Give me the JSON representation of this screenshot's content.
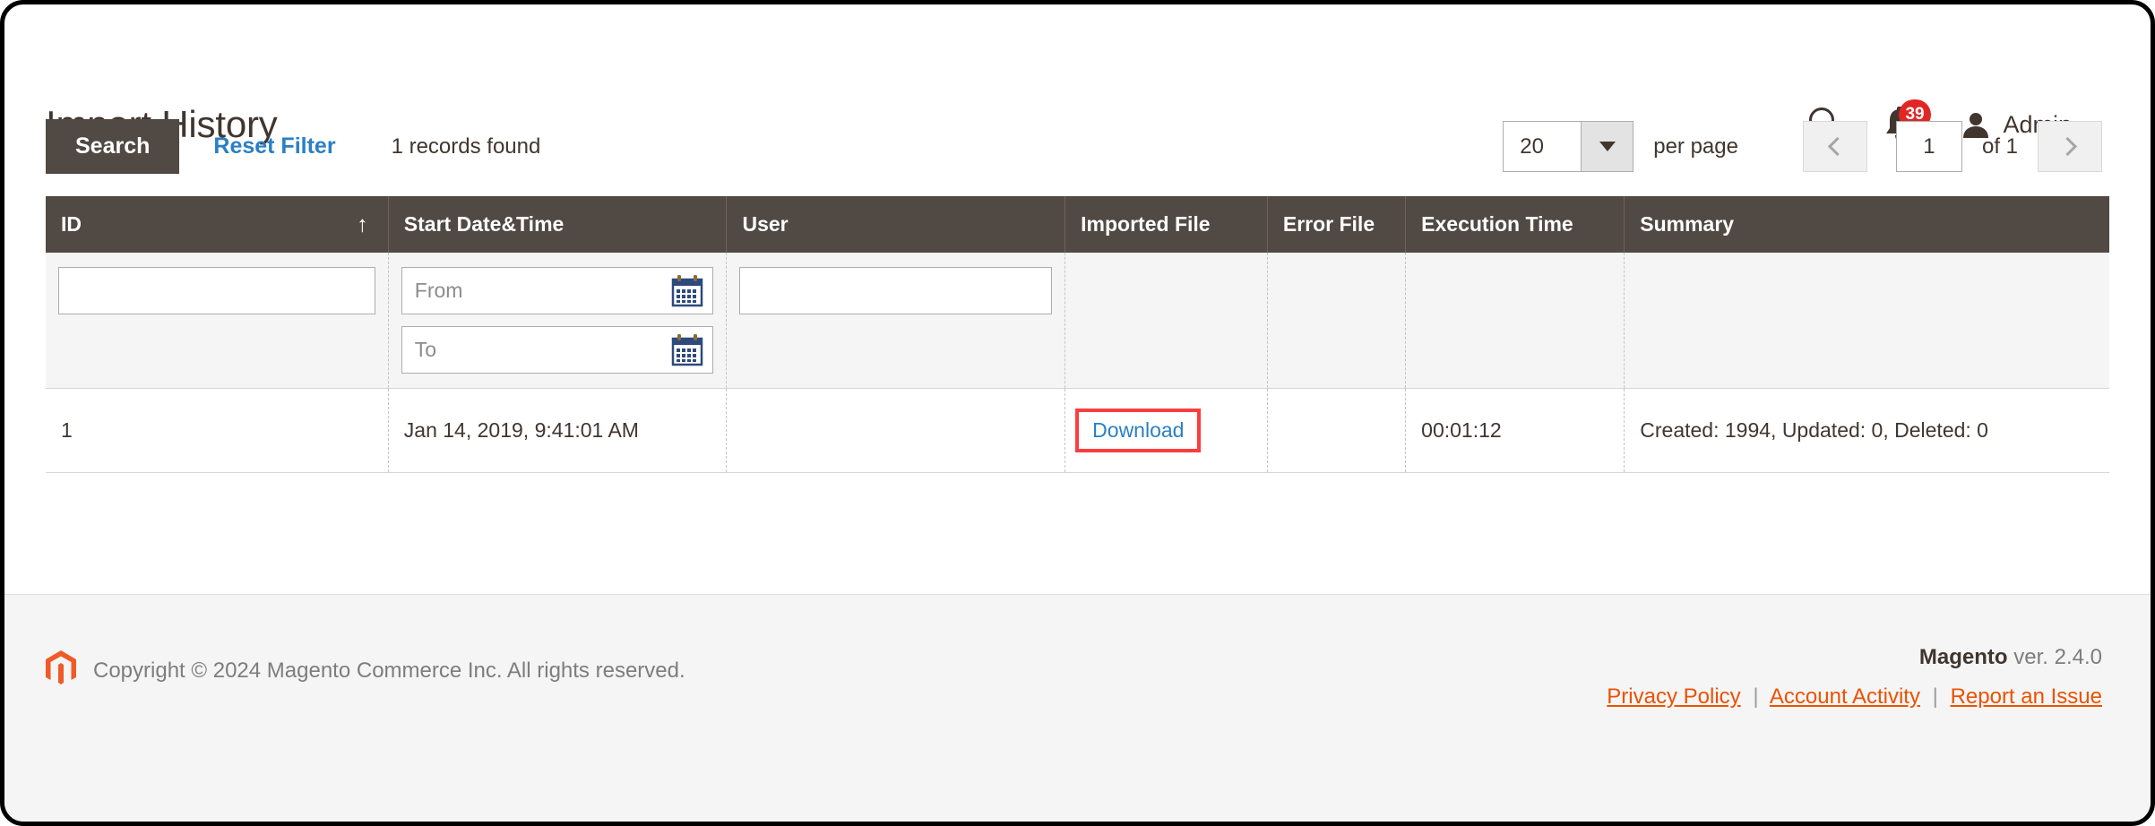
{
  "header": {
    "page_title": "Import History",
    "search_icon": "search-icon",
    "notifications_icon": "bell-icon",
    "notifications_count": "39",
    "user_icon": "user-avatar-icon",
    "user_name": "Admin",
    "caret_icon": "chevron-down-icon"
  },
  "toolbar": {
    "search_label": "Search",
    "reset_filter_label": "Reset Filter",
    "records_found": "1 records found",
    "per_page_value": "20",
    "per_page_label": "per page",
    "prev_icon": "chevron-left-icon",
    "next_icon": "chevron-right-icon",
    "page_value": "1",
    "of_total": "of 1"
  },
  "grid": {
    "columns": [
      {
        "key": "id",
        "label": "ID",
        "sorted": true,
        "sort_icon": "↑"
      },
      {
        "key": "start_datetime",
        "label": "Start Date&Time"
      },
      {
        "key": "user",
        "label": "User"
      },
      {
        "key": "imported_file",
        "label": "Imported File"
      },
      {
        "key": "error_file",
        "label": "Error File"
      },
      {
        "key": "execution_time",
        "label": "Execution Time"
      },
      {
        "key": "summary",
        "label": "Summary"
      }
    ],
    "filters": {
      "id_value": "",
      "id_placeholder": "",
      "date_from_placeholder": "From",
      "date_from_value": "",
      "date_to_placeholder": "To",
      "date_to_value": "",
      "user_value": "",
      "user_placeholder": "",
      "calendar_icon": "calendar-icon"
    },
    "rows": [
      {
        "id": "1",
        "start_datetime": "Jan 14, 2019, 9:41:01 AM",
        "user": "",
        "imported_file_link": "Download",
        "error_file": "",
        "execution_time": "00:01:12",
        "summary": "Created: 1994, Updated: 0, Deleted: 0"
      }
    ]
  },
  "footer": {
    "logo_icon": "magento-logo-icon",
    "copyright": "Copyright © 2024 Magento Commerce Inc. All rights reserved.",
    "brand": "Magento",
    "version": " ver. 2.4.0",
    "links": [
      {
        "label": "Privacy Policy"
      },
      {
        "label": "Account Activity"
      },
      {
        "label": "Report an Issue"
      }
    ],
    "separator": "|"
  },
  "colors": {
    "header_bar": "#514943",
    "accent_orange": "#eb5202",
    "link_blue": "#2a7fc5",
    "badge_red": "#e22626",
    "highlight_red": "#fc3d3d"
  }
}
